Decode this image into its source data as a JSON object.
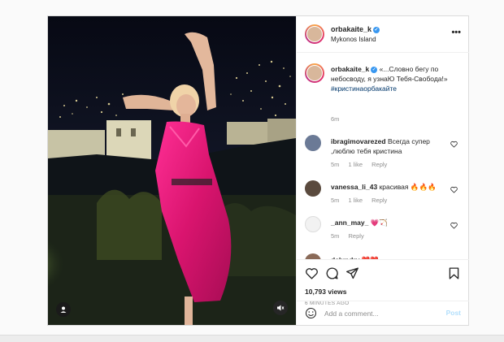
{
  "post": {
    "username": "orbakaite_k",
    "location": "Mykonos Island",
    "more_icon": "ellipsis-icon",
    "caption": {
      "username": "orbakaite_k",
      "text": "«...Словно бегу по небосводу, я узнаЮ Тебя-Свобода!»",
      "hashtag": "#кристинаорбакайте",
      "time": "6m"
    },
    "comments": [
      {
        "username": "ibragimovarezed",
        "text": "Всегда супер ,люблю тебя кристина",
        "time": "5m",
        "likes": "1 like",
        "reply": "Reply"
      },
      {
        "username": "vanessa_li_43",
        "text": "красивая 🔥🔥🔥",
        "time": "5m",
        "likes": "1 like",
        "reply": "Reply"
      },
      {
        "username": "_ann_may_",
        "text": "💗🏹",
        "time": "5m",
        "likes": "",
        "reply": "Reply"
      },
      {
        "username": "dalxndrv",
        "text": "❤️❤️",
        "time": "",
        "likes": "",
        "reply": ""
      }
    ],
    "views": "10,793 views",
    "posted_ago": "6 MINUTES AGO",
    "comment_placeholder": "Add a comment...",
    "post_label": "Post"
  },
  "colors": {
    "accent_blue": "#3897f0",
    "post_disabled": "#b2dffc",
    "dress": "#d9146e"
  }
}
